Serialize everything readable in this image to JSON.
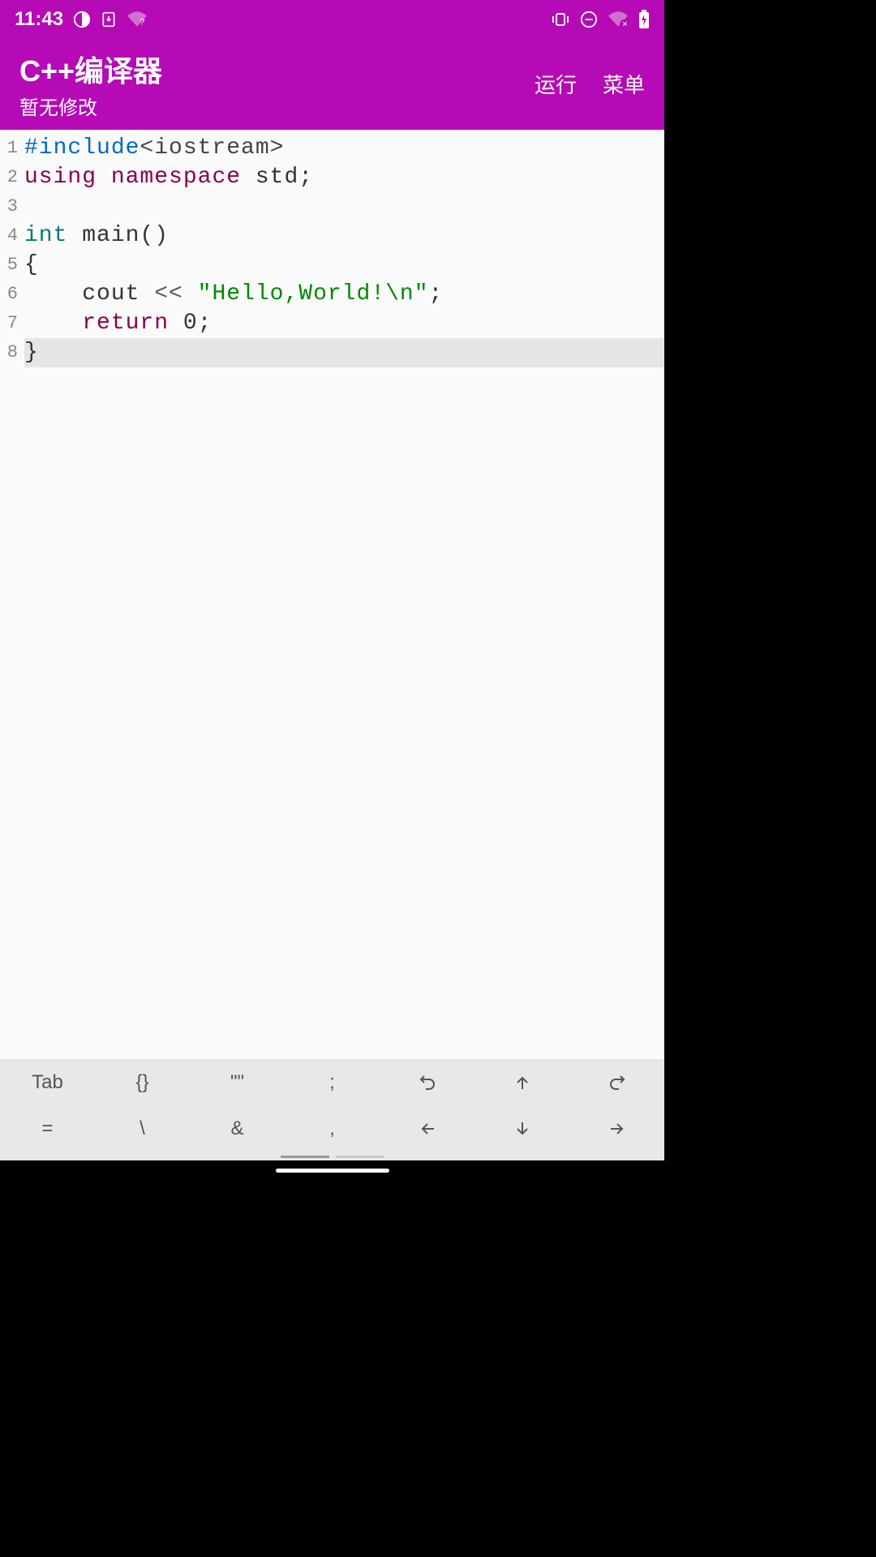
{
  "status": {
    "time": "11:43"
  },
  "appbar": {
    "title": "C++编译器",
    "subtitle": "暂无修改",
    "run": "运行",
    "menu": "菜单"
  },
  "editor": {
    "lines": [
      {
        "n": "1",
        "tokens": [
          {
            "t": "#include",
            "c": "tok-preproc"
          },
          {
            "t": "<iostream>",
            "c": "tok-include"
          }
        ]
      },
      {
        "n": "2",
        "tokens": [
          {
            "t": "using ",
            "c": "tok-kw"
          },
          {
            "t": "namespace ",
            "c": "tok-kw"
          },
          {
            "t": "std;",
            "c": "tok-id"
          }
        ]
      },
      {
        "n": "3",
        "tokens": []
      },
      {
        "n": "4",
        "tokens": [
          {
            "t": "int ",
            "c": "tok-type"
          },
          {
            "t": "main()",
            "c": "tok-id"
          }
        ]
      },
      {
        "n": "5",
        "tokens": [
          {
            "t": "{",
            "c": "tok-id"
          }
        ]
      },
      {
        "n": "6",
        "tokens": [
          {
            "t": "    cout ",
            "c": "tok-id"
          },
          {
            "t": "<< ",
            "c": "tok-op"
          },
          {
            "t": "\"Hello,World!\\n\"",
            "c": "tok-str"
          },
          {
            "t": ";",
            "c": "tok-id"
          }
        ]
      },
      {
        "n": "7",
        "tokens": [
          {
            "t": "    ",
            "c": ""
          },
          {
            "t": "return ",
            "c": "tok-kw"
          },
          {
            "t": "0;",
            "c": "tok-num"
          }
        ]
      },
      {
        "n": "8",
        "highlight": true,
        "tokens": [
          {
            "t": "}",
            "c": "tok-id"
          }
        ]
      }
    ]
  },
  "toolbar": {
    "row1": [
      "Tab",
      "{}",
      "\"\"",
      ";",
      "undo-icon",
      "up-icon",
      "redo-icon"
    ],
    "row2": [
      "=",
      "\\",
      "&",
      ",",
      "left-icon",
      "down-icon",
      "right-icon"
    ]
  }
}
